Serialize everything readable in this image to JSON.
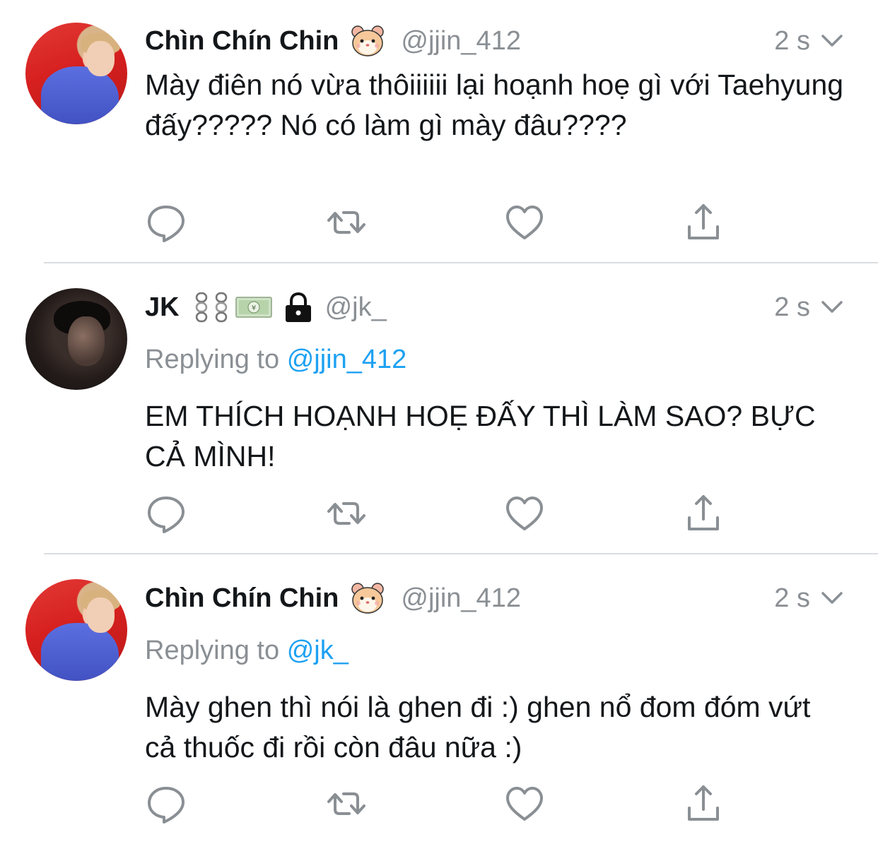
{
  "tweets": [
    {
      "name": "Chìn Chín Chin",
      "emoji": "hamster-face-emoji",
      "handle": "@jjin_412",
      "time": "2 s",
      "text": "Mày điên nó vừa thôiiiiii lại hoạnh hoẹ gì với Taehyung đấy????? Nó có làm gì mày đâu????",
      "avatar": "red"
    },
    {
      "name": "JK",
      "emoji": "chains-money-lock-emoji",
      "handle": "@jk_",
      "time": "2 s",
      "replying_prefix": "Replying to",
      "replying_to": "@jjin_412",
      "text": "EM THÍCH HOẠNH HOẸ ĐẤY THÌ LÀM SAO? BỰC CẢ MÌNH!",
      "avatar": "dark"
    },
    {
      "name": "Chìn Chín Chin",
      "emoji": "hamster-face-emoji",
      "handle": "@jjin_412",
      "time": "2 s",
      "replying_prefix": "Replying to",
      "replying_to": "@jk_",
      "text": "Mày ghen thì nói là ghen đi :) ghen nổ đom đóm vứt cả thuốc đi rồi còn đâu nữa :)",
      "avatar": "red"
    }
  ],
  "colors": {
    "text": "#14171a",
    "muted": "#8a8f94",
    "link": "#1da1f2",
    "divider": "#d9dde0",
    "icon": "#8a8f94"
  },
  "icons": [
    "reply-icon",
    "retweet-icon",
    "like-icon",
    "share-icon",
    "chevron-down-icon"
  ]
}
